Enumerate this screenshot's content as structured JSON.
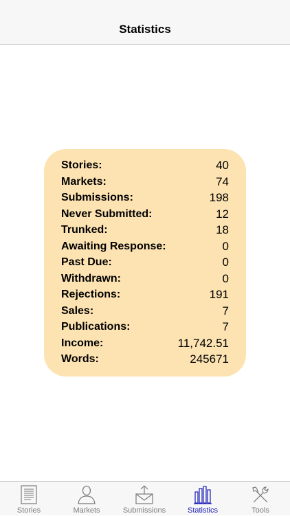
{
  "header": {
    "title": "Statistics"
  },
  "stats": [
    {
      "label": "Stories:",
      "value": "40"
    },
    {
      "label": "Markets:",
      "value": "74"
    },
    {
      "label": "Submissions:",
      "value": "198"
    },
    {
      "label": "Never Submitted:",
      "value": "12"
    },
    {
      "label": "Trunked:",
      "value": "18"
    },
    {
      "label": "Awaiting Response:",
      "value": "0"
    },
    {
      "label": "Past Due:",
      "value": "0"
    },
    {
      "label": "Withdrawn:",
      "value": "0"
    },
    {
      "label": "Rejections:",
      "value": "191"
    },
    {
      "label": "Sales:",
      "value": "7"
    },
    {
      "label": "Publications:",
      "value": "7"
    },
    {
      "label": "Income:",
      "value": "11,742.51"
    },
    {
      "label": "Words:",
      "value": "245671"
    }
  ],
  "tabbar": {
    "tabs": [
      {
        "label": "Stories",
        "icon": "document-icon"
      },
      {
        "label": "Markets",
        "icon": "person-icon"
      },
      {
        "label": "Submissions",
        "icon": "envelope-upload-icon"
      },
      {
        "label": "Statistics",
        "icon": "bar-chart-icon",
        "active": true
      },
      {
        "label": "Tools",
        "icon": "tools-icon"
      }
    ]
  },
  "colors": {
    "card_background": "#fde3b2",
    "active_tab": "#1a1ab8",
    "inactive_tab": "#7a7a7a"
  }
}
